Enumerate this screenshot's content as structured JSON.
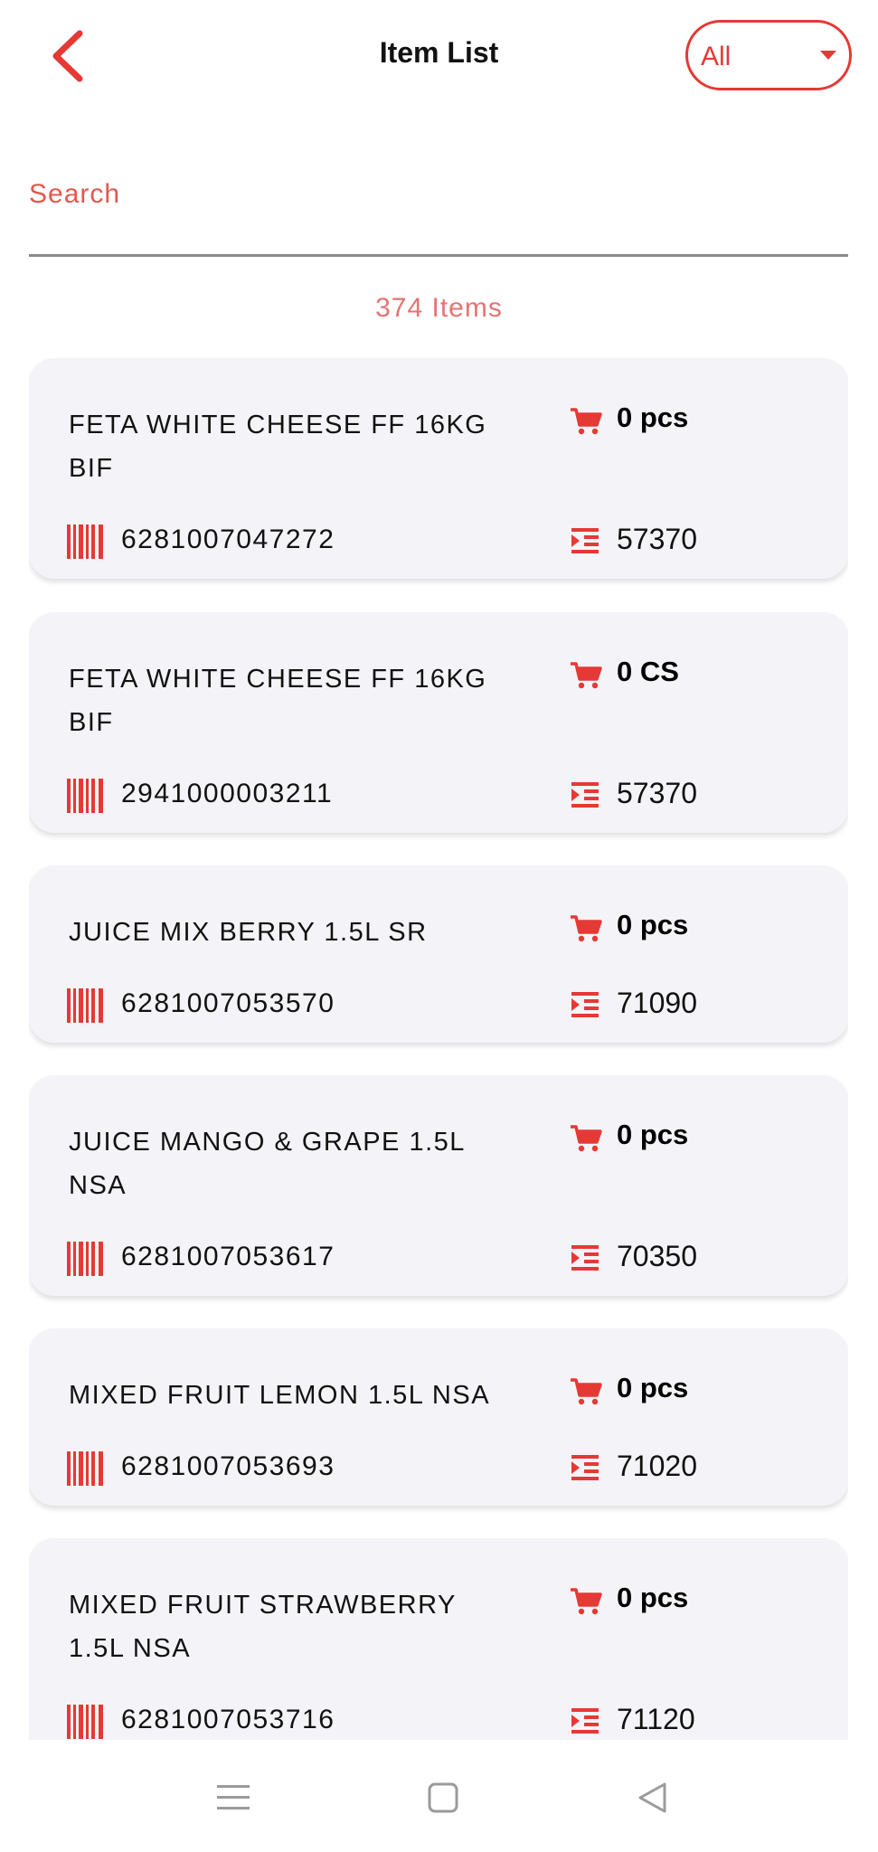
{
  "header": {
    "title": "Item List",
    "filter_value": "All"
  },
  "search": {
    "placeholder": "Search"
  },
  "list_count": "374 Items",
  "colors": {
    "accent": "#e53935",
    "card_bg": "#f4f4f8",
    "count_text": "#e57373"
  },
  "items": [
    {
      "name": "FETA WHITE CHEESE FF 16KG BIF",
      "qty": "0 pcs",
      "barcode": "6281007047272",
      "code": "57370"
    },
    {
      "name": "FETA WHITE CHEESE FF 16KG BIF",
      "qty": "0 CS",
      "barcode": "2941000003211",
      "code": "57370"
    },
    {
      "name": "JUICE MIX BERRY 1.5L SR",
      "qty": "0 pcs",
      "barcode": "6281007053570",
      "code": "71090"
    },
    {
      "name": "JUICE MANGO & GRAPE 1.5L NSA",
      "qty": "0 pcs",
      "barcode": "6281007053617",
      "code": "70350"
    },
    {
      "name": "MIXED FRUIT LEMON 1.5L NSA",
      "qty": "0 pcs",
      "barcode": "6281007053693",
      "code": "71020"
    },
    {
      "name": "MIXED FRUIT STRAWBERRY 1.5L NSA",
      "qty": "0 pcs",
      "barcode": "6281007053716",
      "code": "71120"
    }
  ],
  "icons": {
    "back": "chevron-left-icon",
    "filter": "caret-down-icon",
    "qty": "cart-icon",
    "barcode": "barcode-icon",
    "code": "list-indent-icon",
    "nav": [
      "menu-icon",
      "home-square-icon",
      "back-triangle-icon"
    ]
  }
}
